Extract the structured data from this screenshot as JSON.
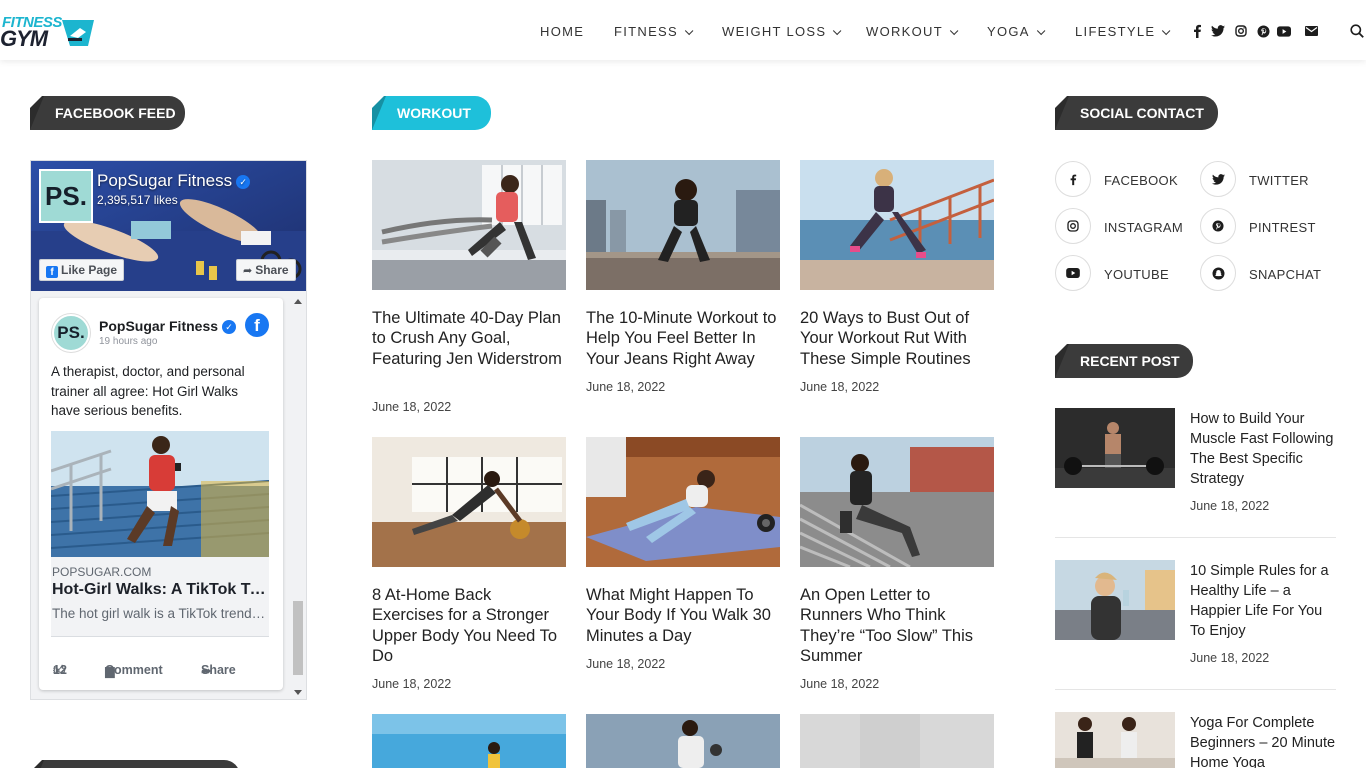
{
  "brand": {
    "line1": "FITNESS",
    "line2": "GYM"
  },
  "nav": {
    "items": [
      {
        "label": "HOME",
        "has_dropdown": false
      },
      {
        "label": "FITNESS",
        "has_dropdown": true
      },
      {
        "label": "WEIGHT LOSS",
        "has_dropdown": true
      },
      {
        "label": "WORKOUT",
        "has_dropdown": true
      },
      {
        "label": "YOGA",
        "has_dropdown": true
      },
      {
        "label": "LIFESTYLE",
        "has_dropdown": true
      }
    ],
    "icons": [
      "facebook-icon",
      "twitter-icon",
      "instagram-icon",
      "pinterest-icon",
      "youtube-icon",
      "mail-icon",
      "search-icon"
    ]
  },
  "left": {
    "heading": "FACEBOOK FEED",
    "fb": {
      "page_name": "PopSugar Fitness",
      "likes": "2,395,517 likes",
      "like_btn": "Like Page",
      "share_btn": "Share",
      "post": {
        "author": "PopSugar Fitness",
        "time": "19 hours ago",
        "text": "A therapist, doctor, and personal trainer all agree: Hot Girl Walks have serious benefits.",
        "link_domain": "POPSUGAR.COM",
        "link_title": "Hot-Girl Walks: A TikTok Trend With Benefits",
        "link_desc": "The hot girl walk is a TikTok trend worth trying",
        "likes": "12",
        "comment": "Comment",
        "share": "Share"
      }
    }
  },
  "main": {
    "heading": "WORKOUT",
    "posts": [
      {
        "title": "The Ultimate 40-Day Plan to Crush Any Goal, Featuring Jen Widerstrom",
        "date": "June 18, 2022"
      },
      {
        "title": "The 10-Minute Workout to Help You Feel Better In Your Jeans Right Away",
        "date": "June 18, 2022"
      },
      {
        "title": "20 Ways to Bust Out of Your Workout Rut With These Simple Routines",
        "date": "June 18, 2022"
      },
      {
        "title": "8 At-Home Back Exercises for a Stronger Upper Body You Need To Do",
        "date": "June 18, 2022"
      },
      {
        "title": "What Might Happen To Your Body If You Walk 30 Minutes a Day",
        "date": "June 18, 2022"
      },
      {
        "title": "An Open Letter to Runners Who Think They’re “Too Slow” This Summer",
        "date": "June 18, 2022"
      }
    ]
  },
  "right": {
    "social_heading": "SOCIAL CONTACT",
    "social": [
      {
        "label": "FACEBOOK",
        "icon": "facebook-icon"
      },
      {
        "label": "TWITTER",
        "icon": "twitter-icon"
      },
      {
        "label": "INSTAGRAM",
        "icon": "instagram-icon"
      },
      {
        "label": "PINTREST",
        "icon": "pinterest-icon"
      },
      {
        "label": "YOUTUBE",
        "icon": "youtube-icon"
      },
      {
        "label": "SNAPCHAT",
        "icon": "snapchat-icon"
      }
    ],
    "recent_heading": "RECENT POST",
    "recent": [
      {
        "title": "How to Build Your Muscle Fast Following The Best Specific Strategy",
        "date": "June 18, 2022"
      },
      {
        "title": "10 Simple Rules for a Healthy Life – a Happier Life For You To Enjoy",
        "date": "June 18, 2022"
      },
      {
        "title": "Yoga For Complete Beginners – 20 Minute Home Yoga",
        "date": ""
      }
    ]
  },
  "colors": {
    "accent": "#1ec0da",
    "dark_tag": "#3b3b3b",
    "facebook_blue": "#1877f2"
  }
}
